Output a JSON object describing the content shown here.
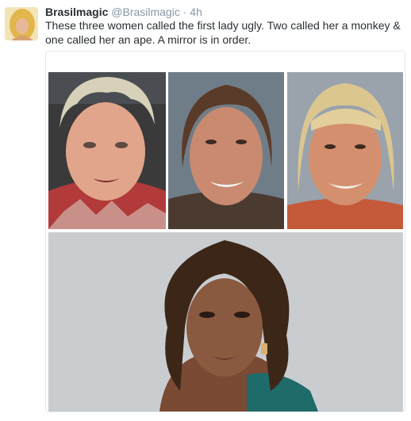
{
  "tweet": {
    "author": {
      "display_name": "Brasilmagic",
      "screen_name": "@Brasilmagic",
      "separator": "·",
      "time": "4h"
    },
    "text": "These three women called the first lady ugly. Two called her a monkey & one called her an ape. A mirror is in order."
  },
  "media": {
    "photo_count": 4
  }
}
